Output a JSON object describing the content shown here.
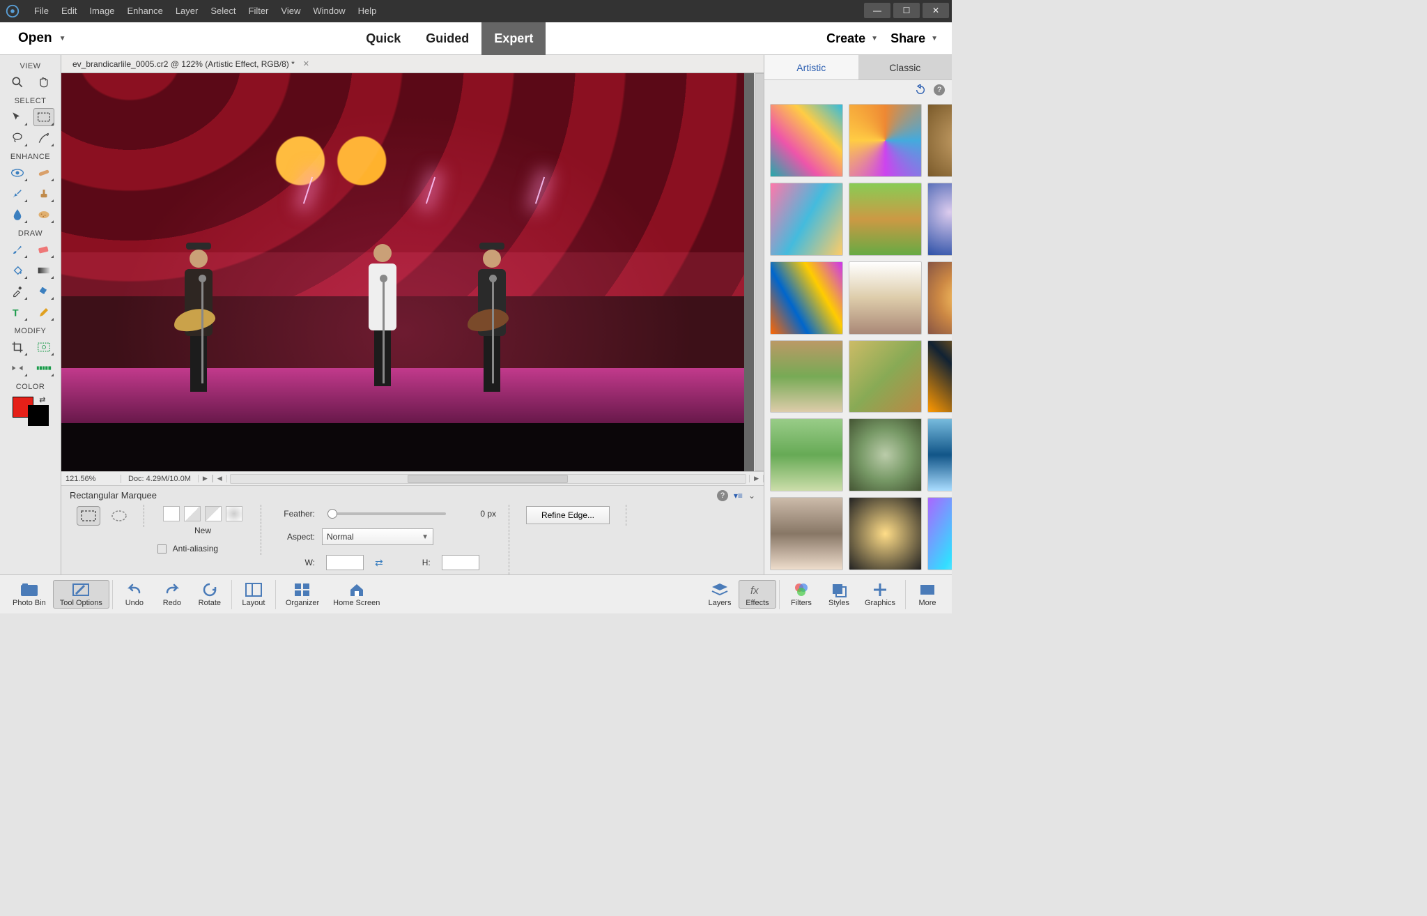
{
  "menu": {
    "items": [
      "File",
      "Edit",
      "Image",
      "Enhance",
      "Layer",
      "Select",
      "Filter",
      "View",
      "Window",
      "Help"
    ]
  },
  "modebar": {
    "open": "Open",
    "tabs": [
      "Quick",
      "Guided",
      "Expert"
    ],
    "active": "Expert",
    "create": "Create",
    "share": "Share"
  },
  "document": {
    "tab_title": "ev_brandicarlile_0005.cr2 @ 122% (Artistic Effect, RGB/8) *",
    "zoom": "121.56%",
    "doc_size": "Doc: 4.29M/10.0M"
  },
  "left_toolbar": {
    "sections": {
      "view": "VIEW",
      "select": "SELECT",
      "enhance": "ENHANCE",
      "draw": "DRAW",
      "modify": "MODIFY",
      "color": "COLOR"
    }
  },
  "tool_options": {
    "title": "Rectangular Marquee",
    "new_label": "New",
    "anti_alias": "Anti-aliasing",
    "feather_label": "Feather:",
    "feather_value": "0 px",
    "aspect_label": "Aspect:",
    "aspect_value": "Normal",
    "w_label": "W:",
    "h_label": "H:",
    "refine": "Refine Edge..."
  },
  "effects_panel": {
    "tabs": {
      "artistic": "Artistic",
      "classic": "Classic"
    },
    "active": "Artistic"
  },
  "taskbar": {
    "left": [
      "Photo Bin",
      "Tool Options",
      "Undo",
      "Redo",
      "Rotate",
      "Layout",
      "Organizer",
      "Home Screen"
    ],
    "right": [
      "Layers",
      "Effects",
      "Filters",
      "Styles",
      "Graphics",
      "More"
    ],
    "active": "Effects",
    "left_active": "Tool Options"
  },
  "colors": {
    "fg": "#e52018",
    "bg": "#000000",
    "accent": "#2a5db0"
  }
}
